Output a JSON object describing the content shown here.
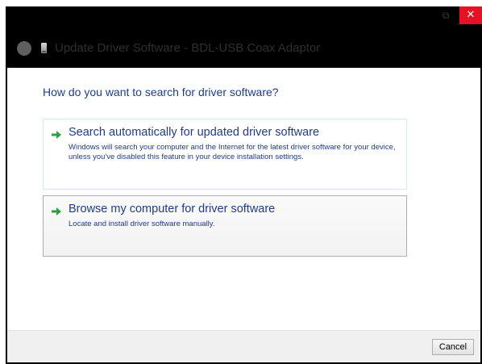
{
  "window": {
    "title": "Update Driver Software - BDL-USB Coax Adaptor",
    "close_glyph": "✕",
    "restore_glyph": "⧉",
    "close_color": "#e81123"
  },
  "main": {
    "question": "How do you want to search for driver software?",
    "options": [
      {
        "title": "Search automatically for updated driver software",
        "description": "Windows will search your computer and the Internet for the latest driver software for your device, unless you've disabled this feature in your device installation settings.",
        "icon": "green-arrow-icon"
      },
      {
        "title": "Browse my computer for driver software",
        "description": "Locate and install driver software manually.",
        "icon": "green-arrow-icon"
      }
    ]
  },
  "footer": {
    "cancel_label": "Cancel"
  },
  "colors": {
    "link_blue": "#1f3c8c",
    "arrow_green": "#2ea043",
    "titlebar": "#000000"
  }
}
